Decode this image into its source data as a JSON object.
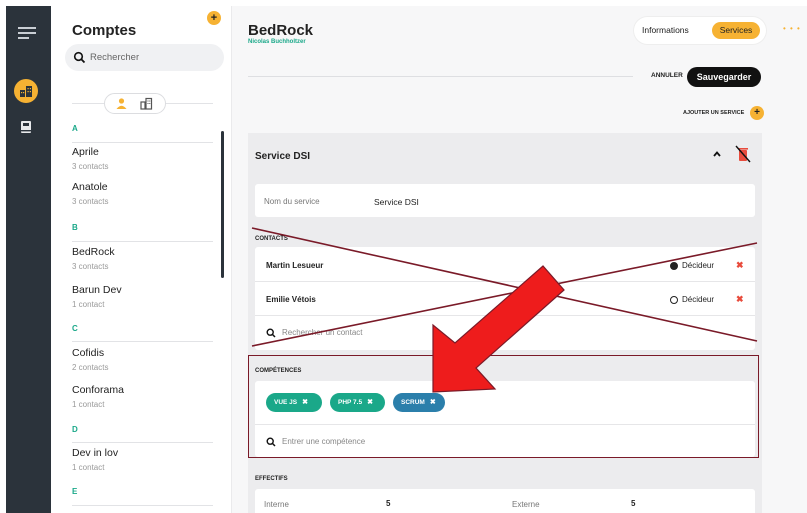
{
  "accounts": {
    "title": "Comptes",
    "add_label": "+",
    "search_placeholder": "Rechercher",
    "groups": [
      {
        "letter": "A",
        "items": [
          {
            "name": "Aprile",
            "sub": "3 contacts"
          },
          {
            "name": "Anatole",
            "sub": "3 contacts"
          }
        ]
      },
      {
        "letter": "B",
        "items": [
          {
            "name": "BedRock",
            "sub": "3 contacts"
          },
          {
            "name": "Barun Dev",
            "sub": "1 contact"
          }
        ]
      },
      {
        "letter": "C",
        "items": [
          {
            "name": "Cofidis",
            "sub": "2 contacts"
          },
          {
            "name": "Conforama",
            "sub": "1 contact"
          }
        ]
      },
      {
        "letter": "D",
        "items": [
          {
            "name": "Dev in lov",
            "sub": "1 contact"
          }
        ]
      },
      {
        "letter": "E",
        "items": []
      }
    ]
  },
  "header": {
    "title": "BedRock",
    "subtitle": "Nicolas Buchholtzer",
    "tab_info": "Informations",
    "tab_services": "Services",
    "more": "• • •",
    "cancel_label": "ANNULER",
    "save_label": "Sauvegarder",
    "add_service_label": "AJOUTER UN SERVICE",
    "add_service_btn": "+"
  },
  "service": {
    "title": "Service DSI",
    "name_label": "Nom du service",
    "name_value": "Service DSI",
    "contacts_header": "CONTACTS",
    "contacts": [
      {
        "name": "Martin Lesueur",
        "role": "Décideur",
        "checked": true
      },
      {
        "name": "Emilie  Vétois",
        "role": "Décideur",
        "checked": false
      }
    ],
    "contact_search_placeholder": "Rechercher un contact",
    "skills_header": "COMPÉTENCES",
    "skills": [
      {
        "label": "VUE JS",
        "color": "#1aa889"
      },
      {
        "label": "PHP 7.5",
        "color": "#1aa889"
      },
      {
        "label": "SCRUM",
        "color": "#2b7fab"
      }
    ],
    "chip_remove": "✖",
    "skill_input_placeholder": "Entrer une compétence",
    "effectifs_header": "EFFECTIFS",
    "effectifs": [
      {
        "label": "Interne",
        "value": "5"
      },
      {
        "label": "Externe",
        "value": "5"
      }
    ],
    "remove_contact": "✖"
  },
  "colors": {
    "accent": "#f6b233",
    "green": "#1aa889",
    "blue": "#2b7fab",
    "rail": "#2b333b",
    "annotation": "#7a1a28",
    "arrow": "#ee1c1c"
  }
}
